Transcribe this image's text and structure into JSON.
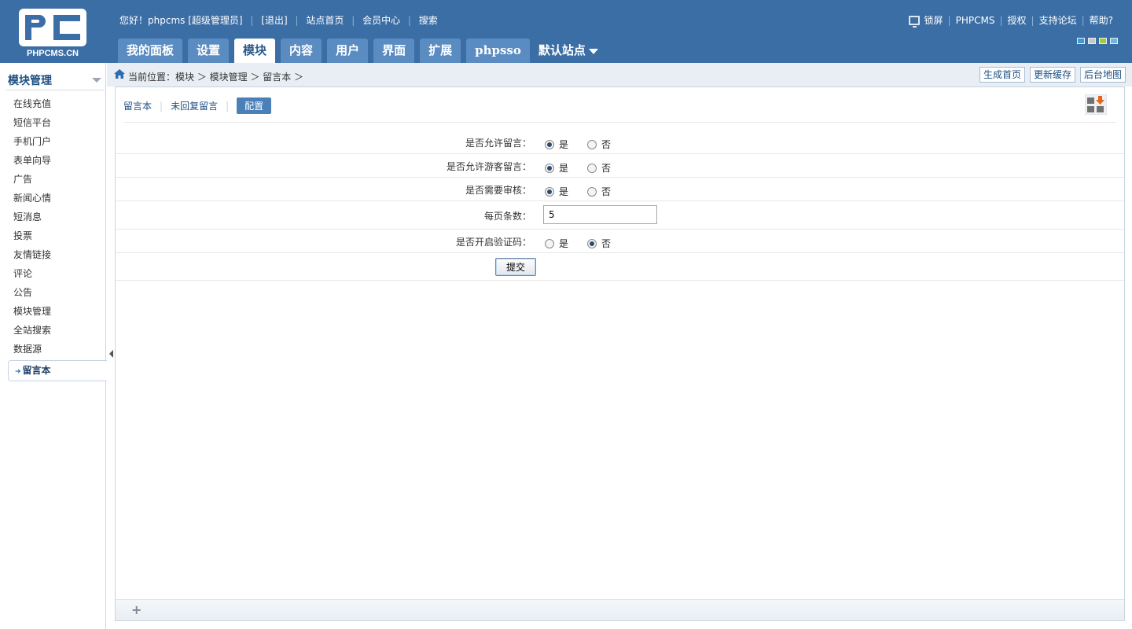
{
  "header": {
    "logo_text": "PHPCMS.CN",
    "greeting": "您好！phpcms [超级管理员]",
    "logout": "[退出]",
    "site_home": "站点首页",
    "member_center": "会员中心",
    "search": "搜索",
    "lock": "锁屏",
    "phpcms": "PHPCMS",
    "license": "授权",
    "forum": "支持论坛",
    "help": "帮助?",
    "skin_colors": [
      "#3d9ad9",
      "#c9c9c9",
      "#a7c93b",
      "#6fb6d8"
    ]
  },
  "tabs": [
    {
      "label": "我的面板"
    },
    {
      "label": "设置"
    },
    {
      "label": "模块"
    },
    {
      "label": "内容"
    },
    {
      "label": "用户"
    },
    {
      "label": "界面"
    },
    {
      "label": "扩展"
    },
    {
      "label": "phpsso"
    }
  ],
  "site_selector": "默认站点",
  "sidebar": {
    "title": "模块管理",
    "items": [
      {
        "label": "在线充值"
      },
      {
        "label": "短信平台"
      },
      {
        "label": "手机门户"
      },
      {
        "label": "表单向导"
      },
      {
        "label": "广告"
      },
      {
        "label": "新闻心情"
      },
      {
        "label": "短消息"
      },
      {
        "label": "投票"
      },
      {
        "label": "友情链接"
      },
      {
        "label": "评论"
      },
      {
        "label": "公告"
      },
      {
        "label": "模块管理"
      },
      {
        "label": "全站搜索"
      },
      {
        "label": "数据源"
      }
    ],
    "active": "留言本"
  },
  "breadcrumb": {
    "text": "当前位置：模块 ＞ 模块管理 ＞ 留言本 ＞"
  },
  "crumb_buttons": {
    "generate_home": "生成首页",
    "update_cache": "更新缓存",
    "site_map": "后台地图"
  },
  "subtabs": {
    "guestbook": "留言本",
    "unreplied": "未回复留言",
    "config": "配置"
  },
  "form": {
    "allow_post": {
      "label": "是否允许留言：",
      "yes": "是",
      "no": "否",
      "value": "yes"
    },
    "allow_guest": {
      "label": "是否允许游客留言：",
      "yes": "是",
      "no": "否",
      "value": "yes"
    },
    "need_check": {
      "label": "是否需要审核：",
      "yes": "是",
      "no": "否",
      "value": "yes"
    },
    "per_page": {
      "label": "每页条数：",
      "value": "5"
    },
    "captcha": {
      "label": "是否开启验证码：",
      "yes": "是",
      "no": "否",
      "value": "no"
    },
    "submit": "提交"
  },
  "footer": {
    "plus": "+"
  }
}
